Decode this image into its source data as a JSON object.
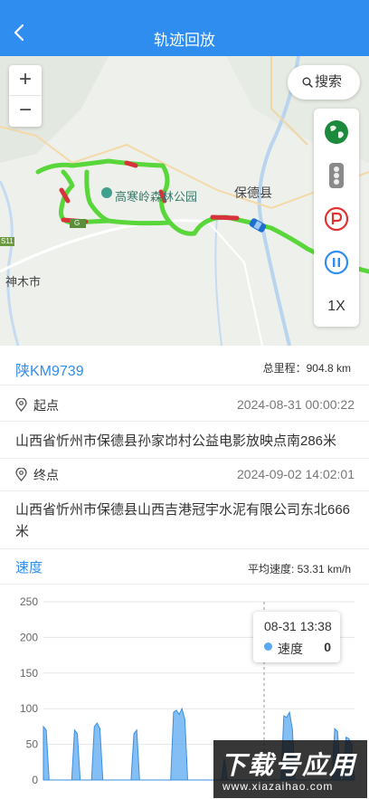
{
  "header": {
    "title": "轨迹回放"
  },
  "map": {
    "zoom_in": "+",
    "zoom_out": "−",
    "search_label": "搜索",
    "labels": {
      "park": "高寒岭森林公园",
      "county": "保德县",
      "city": "神木市",
      "road_badge_1": "S11",
      "road_badge_2": "G"
    },
    "tools": {
      "speed": "1X"
    }
  },
  "vehicle": {
    "plate": "陕KM9739",
    "mileage": "总里程：904.8 km"
  },
  "start": {
    "label": "起点",
    "time": "2024-08-31 00:00:22",
    "address": "山西省忻州市保德县孙家岇村公益电影放映点南286米"
  },
  "end": {
    "label": "终点",
    "time": "2024-09-02 14:02:01",
    "address": "山西省忻州市保德县山西吉港冠宇水泥有限公司东北666米"
  },
  "speed_section": {
    "label": "速度",
    "average": "平均速度: 53.31 km/h"
  },
  "chart_data": {
    "type": "area",
    "ylim": [
      0,
      250
    ],
    "yticks": [
      "250",
      "200",
      "150",
      "100",
      "50",
      "0"
    ],
    "series": [
      {
        "name": "速度",
        "color": "#5aa8f0",
        "values": [
          75,
          70,
          0,
          0,
          0,
          0,
          0,
          0,
          0,
          0,
          0,
          70,
          65,
          0,
          0,
          0,
          0,
          0,
          75,
          80,
          72,
          0,
          0,
          0,
          0,
          0,
          0,
          0,
          0,
          0,
          0,
          0,
          65,
          70,
          0,
          0,
          0,
          0,
          0,
          0,
          0,
          0,
          0,
          0,
          0,
          0,
          95,
          98,
          92,
          100,
          85,
          0,
          0,
          0,
          0,
          0,
          0,
          0,
          0,
          0,
          0,
          0,
          0,
          0,
          30,
          0,
          0,
          0,
          0,
          0,
          0,
          0,
          0,
          0,
          0,
          0,
          0,
          0,
          0,
          0,
          0,
          0,
          0,
          0,
          0,
          90,
          88,
          95,
          72,
          0,
          0,
          0,
          0,
          0,
          0,
          0,
          0,
          0,
          0,
          0,
          0,
          0,
          0,
          72,
          68,
          0,
          0,
          60,
          58,
          50,
          0
        ]
      }
    ],
    "tooltip": {
      "title": "08-31 13:38",
      "name": "速度",
      "value": "0"
    }
  },
  "watermark": {
    "title": "下载号应用",
    "url": "www.xiazaihao.com"
  },
  "colors": {
    "primary": "#2f8df0",
    "route": "#58d63a",
    "route_slow": "#d6343a"
  }
}
